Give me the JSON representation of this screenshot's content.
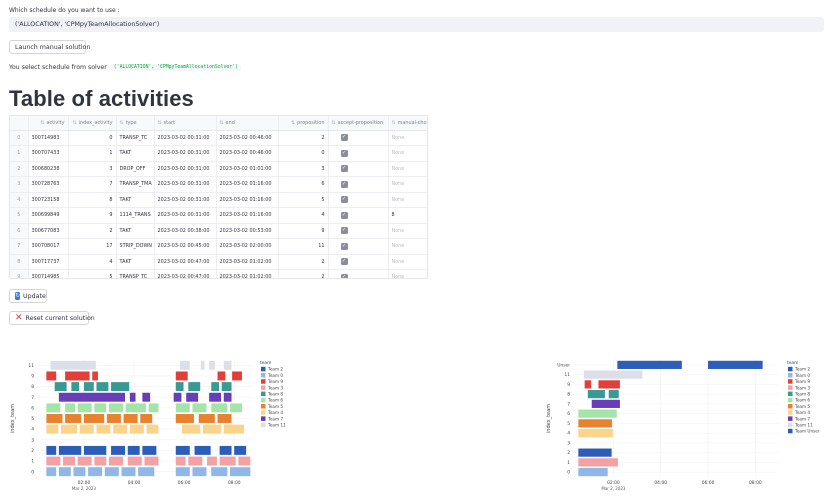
{
  "question": "Which schedule do you want to use :",
  "select_value": "('ALLOCATION', 'CPMpyTeamAllocationSolver')",
  "launch_button": "Launch manual solution",
  "selected_prefix": "You select schedule from solver",
  "selected_code": "('ALLOCATION', 'CPMpyTeamAllocationSolver')",
  "heading": "Table of activities",
  "table": {
    "columns": [
      "",
      "activity",
      "index_activity",
      "type",
      "start",
      "end",
      "proposition",
      "accept-proposition",
      "manual-choice"
    ],
    "rows": [
      {
        "idx": "0",
        "activity": "300714983",
        "index_activity": "0",
        "type": "TRANSP_TC",
        "start": "2023-03-02 00:31:00",
        "end": "2023-03-02 00:46:00",
        "proposition": "2",
        "manual": "None"
      },
      {
        "idx": "1",
        "activity": "300707433",
        "index_activity": "1",
        "type": "TAKT",
        "start": "2023-03-02 00:31:00",
        "end": "2023-03-02 00:46:00",
        "proposition": "0",
        "manual": "None"
      },
      {
        "idx": "2",
        "activity": "300680238",
        "index_activity": "3",
        "type": "DROP_OFF",
        "start": "2023-03-02 00:31:00",
        "end": "2023-03-02 01:01:00",
        "proposition": "3",
        "manual": "None"
      },
      {
        "idx": "3",
        "activity": "300728763",
        "index_activity": "7",
        "type": "TRANSP_TMA",
        "start": "2023-03-02 00:31:00",
        "end": "2023-03-02 01:16:00",
        "proposition": "6",
        "manual": "None"
      },
      {
        "idx": "4",
        "activity": "300723158",
        "index_activity": "8",
        "type": "TAKT",
        "start": "2023-03-02 00:31:00",
        "end": "2023-03-02 01:16:00",
        "proposition": "5",
        "manual": "None"
      },
      {
        "idx": "5",
        "activity": "300699849",
        "index_activity": "9",
        "type": "1114_TRANS",
        "start": "2023-03-02 00:31:00",
        "end": "2023-03-02 01:16:00",
        "proposition": "4",
        "manual": "8"
      },
      {
        "idx": "6",
        "activity": "300677083",
        "index_activity": "2",
        "type": "TAKT",
        "start": "2023-03-02 00:38:00",
        "end": "2023-03-02 00:53:00",
        "proposition": "9",
        "manual": "None"
      },
      {
        "idx": "7",
        "activity": "300708017",
        "index_activity": "17",
        "type": "STRIP_DOWN",
        "start": "2023-03-02 00:45:00",
        "end": "2023-03-02 02:00:00",
        "proposition": "11",
        "manual": "None"
      },
      {
        "idx": "8",
        "activity": "300717737",
        "index_activity": "4",
        "type": "TAKT",
        "start": "2023-03-02 00:47:00",
        "end": "2023-03-02 01:02:00",
        "proposition": "2",
        "manual": "None"
      },
      {
        "idx": "9",
        "activity": "300714985",
        "index_activity": "5",
        "type": "TRANSP_TC",
        "start": "2023-03-02 00:47:00",
        "end": "2023-03-02 01:02:00",
        "proposition": "2",
        "manual": "None"
      }
    ]
  },
  "update_button": "Update",
  "reset_button": "Reset current solution",
  "chart_data": [
    {
      "type": "gantt",
      "ylabel": "index_team",
      "legend_title": "team",
      "legend_position": "right",
      "y_ticks": [
        "0",
        "1",
        "2",
        "3",
        "4",
        "5",
        "6",
        "7",
        "8",
        "9",
        "11"
      ],
      "x_ticks": [
        "02:00",
        "04:00",
        "06:00",
        "08:00"
      ],
      "x_subtitle": "Mar 2, 2023",
      "x_range": [
        "00:10",
        "08:45"
      ],
      "series": [
        {
          "name": "Team 2",
          "color": "#2c5eb8",
          "row": "2",
          "intervals": [
            [
              "00:30",
              "00:55"
            ],
            [
              "01:00",
              "01:55"
            ],
            [
              "02:00",
              "02:55"
            ],
            [
              "03:05",
              "03:40"
            ],
            [
              "03:45",
              "04:15"
            ],
            [
              "04:20",
              "04:55"
            ],
            [
              "05:40",
              "06:15"
            ],
            [
              "06:25",
              "07:05"
            ],
            [
              "07:25",
              "07:55"
            ],
            [
              "08:00",
              "08:30"
            ]
          ]
        },
        {
          "name": "Team 0",
          "color": "#8fb8e8",
          "row": "0",
          "intervals": [
            [
              "00:30",
              "00:55"
            ],
            [
              "01:00",
              "01:30"
            ],
            [
              "01:35",
              "02:05"
            ],
            [
              "02:10",
              "02:45"
            ],
            [
              "02:50",
              "03:25"
            ],
            [
              "03:30",
              "04:05"
            ],
            [
              "04:10",
              "04:50"
            ],
            [
              "05:40",
              "06:15"
            ],
            [
              "06:20",
              "06:55"
            ],
            [
              "07:05",
              "07:45"
            ],
            [
              "07:50",
              "08:40"
            ]
          ]
        },
        {
          "name": "Team 9",
          "color": "#e43e3a",
          "row": "9",
          "intervals": [
            [
              "00:30",
              "00:55"
            ],
            [
              "01:15",
              "02:15"
            ],
            [
              "02:20",
              "02:35"
            ],
            [
              "05:40",
              "06:10"
            ],
            [
              "07:20",
              "07:40"
            ],
            [
              "07:55",
              "08:20"
            ]
          ]
        },
        {
          "name": "Team 3",
          "color": "#f4a1a3",
          "row": "1",
          "intervals": [
            [
              "00:30",
              "01:05"
            ],
            [
              "01:10",
              "01:40"
            ],
            [
              "01:45",
              "02:20"
            ],
            [
              "02:25",
              "02:55"
            ],
            [
              "03:00",
              "03:35"
            ],
            [
              "03:45",
              "04:20"
            ],
            [
              "04:25",
              "05:00"
            ],
            [
              "05:40",
              "06:05"
            ],
            [
              "06:10",
              "06:45"
            ],
            [
              "06:55",
              "07:20"
            ],
            [
              "07:25",
              "08:05"
            ],
            [
              "08:10",
              "08:40"
            ]
          ]
        },
        {
          "name": "Team 8",
          "color": "#3a9a93",
          "row": "8",
          "intervals": [
            [
              "00:50",
              "01:20"
            ],
            [
              "01:30",
              "01:50"
            ],
            [
              "02:00",
              "02:25"
            ],
            [
              "02:30",
              "03:00"
            ],
            [
              "03:05",
              "03:50"
            ],
            [
              "05:40",
              "06:00"
            ],
            [
              "06:10",
              "06:40"
            ],
            [
              "07:05",
              "07:25"
            ],
            [
              "07:30",
              "07:55"
            ]
          ]
        },
        {
          "name": "Team 6",
          "color": "#a3e4a8",
          "row": "6",
          "intervals": [
            [
              "00:30",
              "01:05"
            ],
            [
              "01:15",
              "01:40"
            ],
            [
              "01:45",
              "02:20"
            ],
            [
              "02:25",
              "02:55"
            ],
            [
              "03:00",
              "03:35"
            ],
            [
              "03:40",
              "04:30"
            ],
            [
              "04:35",
              "05:00"
            ],
            [
              "05:40",
              "06:15"
            ],
            [
              "06:20",
              "06:55"
            ],
            [
              "07:05",
              "07:45"
            ],
            [
              "07:50",
              "08:20"
            ]
          ]
        },
        {
          "name": "Team 5",
          "color": "#e8822f",
          "row": "5",
          "intervals": [
            [
              "00:30",
              "01:10"
            ],
            [
              "01:15",
              "01:55"
            ],
            [
              "02:00",
              "02:50"
            ],
            [
              "02:55",
              "03:30"
            ],
            [
              "03:35",
              "04:10"
            ],
            [
              "04:15",
              "04:45"
            ],
            [
              "05:40",
              "06:25"
            ],
            [
              "06:35",
              "07:15"
            ],
            [
              "07:20",
              "07:55"
            ]
          ]
        },
        {
          "name": "Team 4",
          "color": "#fbd48b",
          "row": "4",
          "intervals": [
            [
              "00:30",
              "01:00"
            ],
            [
              "01:05",
              "01:45"
            ],
            [
              "01:50",
              "02:25"
            ],
            [
              "02:30",
              "03:05"
            ],
            [
              "03:10",
              "03:45"
            ],
            [
              "03:50",
              "04:25"
            ],
            [
              "04:30",
              "05:00"
            ],
            [
              "05:55",
              "06:40"
            ],
            [
              "06:45",
              "07:30"
            ],
            [
              "07:35",
              "08:25"
            ]
          ]
        },
        {
          "name": "Team 7",
          "color": "#6a3db8",
          "row": "7",
          "intervals": [
            [
              "01:00",
              "03:40"
            ],
            [
              "03:50",
              "04:05"
            ],
            [
              "04:20",
              "04:40"
            ],
            [
              "05:35",
              "05:55"
            ],
            [
              "06:05",
              "06:35"
            ],
            [
              "07:00",
              "07:30"
            ],
            [
              "07:35",
              "07:55"
            ]
          ]
        },
        {
          "name": "Team 11",
          "color": "#dcdfe8",
          "row": "11",
          "intervals": [
            [
              "00:40",
              "02:30"
            ],
            [
              "05:50",
              "06:15"
            ],
            [
              "06:40",
              "06:50"
            ],
            [
              "07:00",
              "07:15"
            ],
            [
              "07:35",
              "07:55"
            ]
          ]
        }
      ]
    },
    {
      "type": "gantt",
      "ylabel": "index_team",
      "legend_title": "team",
      "legend_position": "right",
      "y_ticks": [
        "0",
        "1",
        "2",
        "3",
        "4",
        "5",
        "6",
        "7",
        "8",
        "9",
        "11",
        "Unser"
      ],
      "x_ticks": [
        "02:00",
        "04:00",
        "06:00",
        "08:00"
      ],
      "x_subtitle": "Mar 2, 2023",
      "x_range": [
        "00:20",
        "09:00"
      ],
      "series": [
        {
          "name": "Team 2",
          "color": "#2c5eb8",
          "row": "2",
          "intervals": [
            [
              "00:31",
              "01:57"
            ]
          ]
        },
        {
          "name": "Team 0",
          "color": "#8fb8e8",
          "row": "0",
          "intervals": [
            [
              "00:31",
              "01:47"
            ]
          ]
        },
        {
          "name": "Team 9",
          "color": "#e43e3a",
          "row": "9",
          "intervals": [
            [
              "00:47",
              "01:05"
            ],
            [
              "01:22",
              "02:18"
            ]
          ]
        },
        {
          "name": "Team 3",
          "color": "#f4a1a3",
          "row": "1",
          "intervals": [
            [
              "00:31",
              "02:13"
            ]
          ]
        },
        {
          "name": "Team 8",
          "color": "#3a9a93",
          "row": "8",
          "intervals": [
            [
              "00:55",
              "01:40"
            ],
            [
              "01:48",
              "02:15"
            ]
          ]
        },
        {
          "name": "Team 6",
          "color": "#a3e4a8",
          "row": "6",
          "intervals": [
            [
              "00:31",
              "02:10"
            ]
          ]
        },
        {
          "name": "Team 5",
          "color": "#e8822f",
          "row": "5",
          "intervals": [
            [
              "00:31",
              "01:58"
            ]
          ]
        },
        {
          "name": "Team 4",
          "color": "#fbd48b",
          "row": "4",
          "intervals": [
            [
              "00:31",
              "02:00"
            ]
          ]
        },
        {
          "name": "Team 7",
          "color": "#6a3db8",
          "row": "7",
          "intervals": [
            [
              "01:05",
              "02:18"
            ]
          ]
        },
        {
          "name": "Team 11",
          "color": "#dcdfe8",
          "row": "11",
          "intervals": [
            [
              "00:45",
              "03:15"
            ]
          ]
        },
        {
          "name": "Team Unser",
          "color": "#2c5eb8",
          "row": "Unser",
          "intervals": [
            [
              "02:10",
              "04:55"
            ],
            [
              "06:00",
              "08:20"
            ]
          ]
        }
      ]
    }
  ]
}
